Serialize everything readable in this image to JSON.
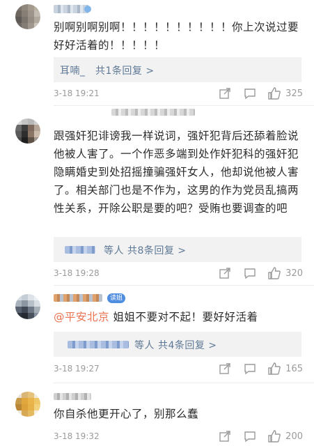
{
  "comments": [
    {
      "text": "别啊别啊别啊！！！！！！！！！！你上次说过要好好活着的！！！！！",
      "reply_prefix": "耳喃_",
      "reply_suffix": "共1条回复 >",
      "time": "3-18 19:21",
      "likes": "325"
    },
    {
      "text": "跟强奸犯诽谤我一样说词，强奸犯背后还舔着脸说他被人害了。一个作恶多端到处作奸犯科的强奸犯隐瞒婚史到处招摇撞骗强奸女人，他却说他被人害了。相关部门也是不作为，这男的作为党员乱搞两性关系，开除公职是要的吧？受贿也要调查的吧",
      "reply_suffix": "等人  共8条回复 >",
      "time": "3-18 19:28",
      "likes": "320"
    },
    {
      "mention": "@平安北京",
      "text": "  姐姐不要对不起！要好好活着",
      "reply_suffix": "等人  共4条回复 >",
      "time": "3-18 19:27",
      "likes": "165",
      "badge": "读姐"
    },
    {
      "text": "你自杀他更开心了，别那么蠢",
      "time": "3-18 19:32",
      "likes": "200"
    }
  ],
  "colors": {
    "text": "#2b2b2b",
    "link": "#5d7895",
    "mention": "#eb7350",
    "meta": "#9a9a9a",
    "reply_bg": "#f2f2f2"
  },
  "icons": [
    "share-icon",
    "comment-icon",
    "like-icon"
  ]
}
